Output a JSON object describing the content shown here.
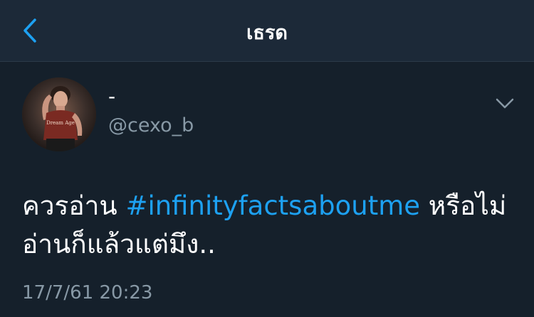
{
  "nav": {
    "title": "เธรด",
    "back_icon": "chevron-left-icon"
  },
  "colors": {
    "background": "#15202b",
    "navbar": "#1c2938",
    "accent": "#1da1f2",
    "secondary_text": "#8899a6"
  },
  "tweet": {
    "display_name": "-",
    "handle": "@cexo_b",
    "more_icon": "chevron-down-icon",
    "text_before": "ควรอ่าน ",
    "hashtag": "#infinityfactsaboutme",
    "text_after": " หรือไม่อ่านก็แล้วแต่มึง..",
    "timestamp": "17/7/61 20:23"
  }
}
